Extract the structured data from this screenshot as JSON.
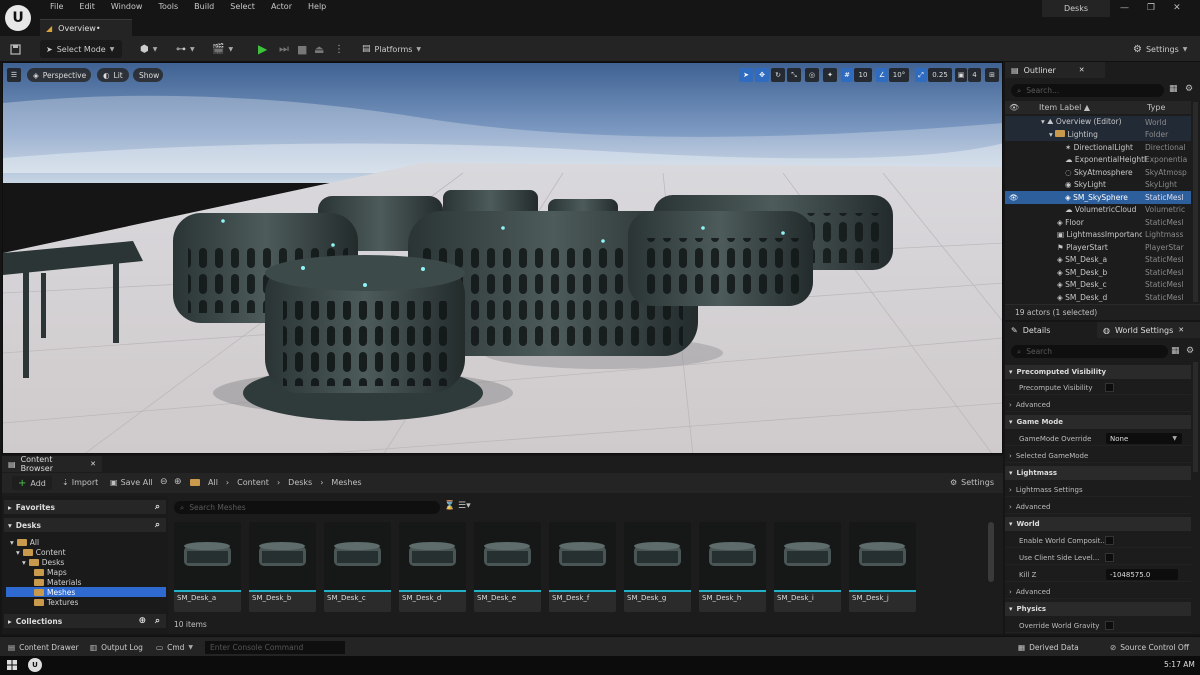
{
  "titlebar": {
    "menu": [
      "File",
      "Edit",
      "Window",
      "Tools",
      "Build",
      "Select",
      "Actor",
      "Help"
    ],
    "doc_tab": "Overview•",
    "project_name": "Desks"
  },
  "toolbar": {
    "select_mode": "Select Mode",
    "platforms": "Platforms",
    "settings": "Settings"
  },
  "viewport": {
    "perspective": "Perspective",
    "lit": "Lit",
    "show": "Show",
    "grid_snap": "10",
    "rot_snap": "10°",
    "scale_snap": "0.25",
    "camera_speed": "4"
  },
  "outliner": {
    "tab": "Outliner",
    "search_placeholder": "Search...",
    "col_label": "Item Label ▲",
    "col_type": "Type",
    "rows": [
      {
        "label": "Overview (Editor)",
        "type": "World"
      },
      {
        "label": "Lighting",
        "type": "Folder"
      },
      {
        "label": "DirectionalLight",
        "type": "Directional"
      },
      {
        "label": "ExponentialHeightF",
        "type": "Exponentia"
      },
      {
        "label": "SkyAtmosphere",
        "type": "SkyAtmosp"
      },
      {
        "label": "SkyLight",
        "type": "SkyLight"
      },
      {
        "label": "SM_SkySphere",
        "type": "StaticMesl"
      },
      {
        "label": "VolumetricCloud",
        "type": "Volumetric"
      },
      {
        "label": "Floor",
        "type": "StaticMesl"
      },
      {
        "label": "LightmassImportanc",
        "type": "Lightmass"
      },
      {
        "label": "PlayerStart",
        "type": "PlayerStar"
      },
      {
        "label": "SM_Desk_a",
        "type": "StaticMesl"
      },
      {
        "label": "SM_Desk_b",
        "type": "StaticMesl"
      },
      {
        "label": "SM_Desk_c",
        "type": "StaticMesl"
      },
      {
        "label": "SM_Desk_d",
        "type": "StaticMesl"
      }
    ],
    "status": "19 actors (1 selected)"
  },
  "details": {
    "tab_details": "Details",
    "tab_world": "World Settings",
    "search_placeholder": "Search",
    "sections": {
      "precomputed": "Precomputed Visibility",
      "game_mode": "Game Mode",
      "lightmass": "Lightmass",
      "world": "World",
      "physics": "Physics"
    },
    "props": {
      "precompute_visibility": "Precompute Visibility",
      "advanced": "Advanced",
      "gamemode_override": "GameMode Override",
      "gamemode_value": "None",
      "selected_gamemode": "Selected GameMode",
      "lightmass_settings": "Lightmass Settings",
      "enable_world_comp": "Enable World Composit...",
      "use_client_side": "Use Client Side Level...",
      "kill_z": "Kill Z",
      "kill_z_value": "-1048575.0",
      "override_gravity": "Override World Gravity"
    }
  },
  "content_browser": {
    "tab": "Content Browser",
    "add": "Add",
    "import": "Import",
    "save_all": "Save All",
    "breadcrumb": [
      "All",
      "Content",
      "Desks",
      "Meshes"
    ],
    "settings": "Settings",
    "favorites": "Favorites",
    "desks": "Desks",
    "tree": [
      "All",
      "Content",
      "Desks",
      "Maps",
      "Materials",
      "Meshes",
      "Textures"
    ],
    "collections": "Collections",
    "search_placeholder": "Search Meshes",
    "assets": [
      "SM_Desk_a",
      "SM_Desk_b",
      "SM_Desk_c",
      "SM_Desk_d",
      "SM_Desk_e",
      "SM_Desk_f",
      "SM_Desk_g",
      "SM_Desk_h",
      "SM_Desk_i",
      "SM_Desk_j"
    ],
    "item_count": "10 items"
  },
  "statusbar": {
    "content_drawer": "Content Drawer",
    "output_log": "Output Log",
    "cmd": "Cmd",
    "console_placeholder": "Enter Console Command",
    "derived_data": "Derived Data",
    "source_control": "Source Control Off"
  },
  "taskbar": {
    "clock": "5:17 AM"
  },
  "colors": {
    "accent_blue": "#2e6ad0",
    "asset_bar": "#21b2c8",
    "play_green": "#3ec43a"
  }
}
